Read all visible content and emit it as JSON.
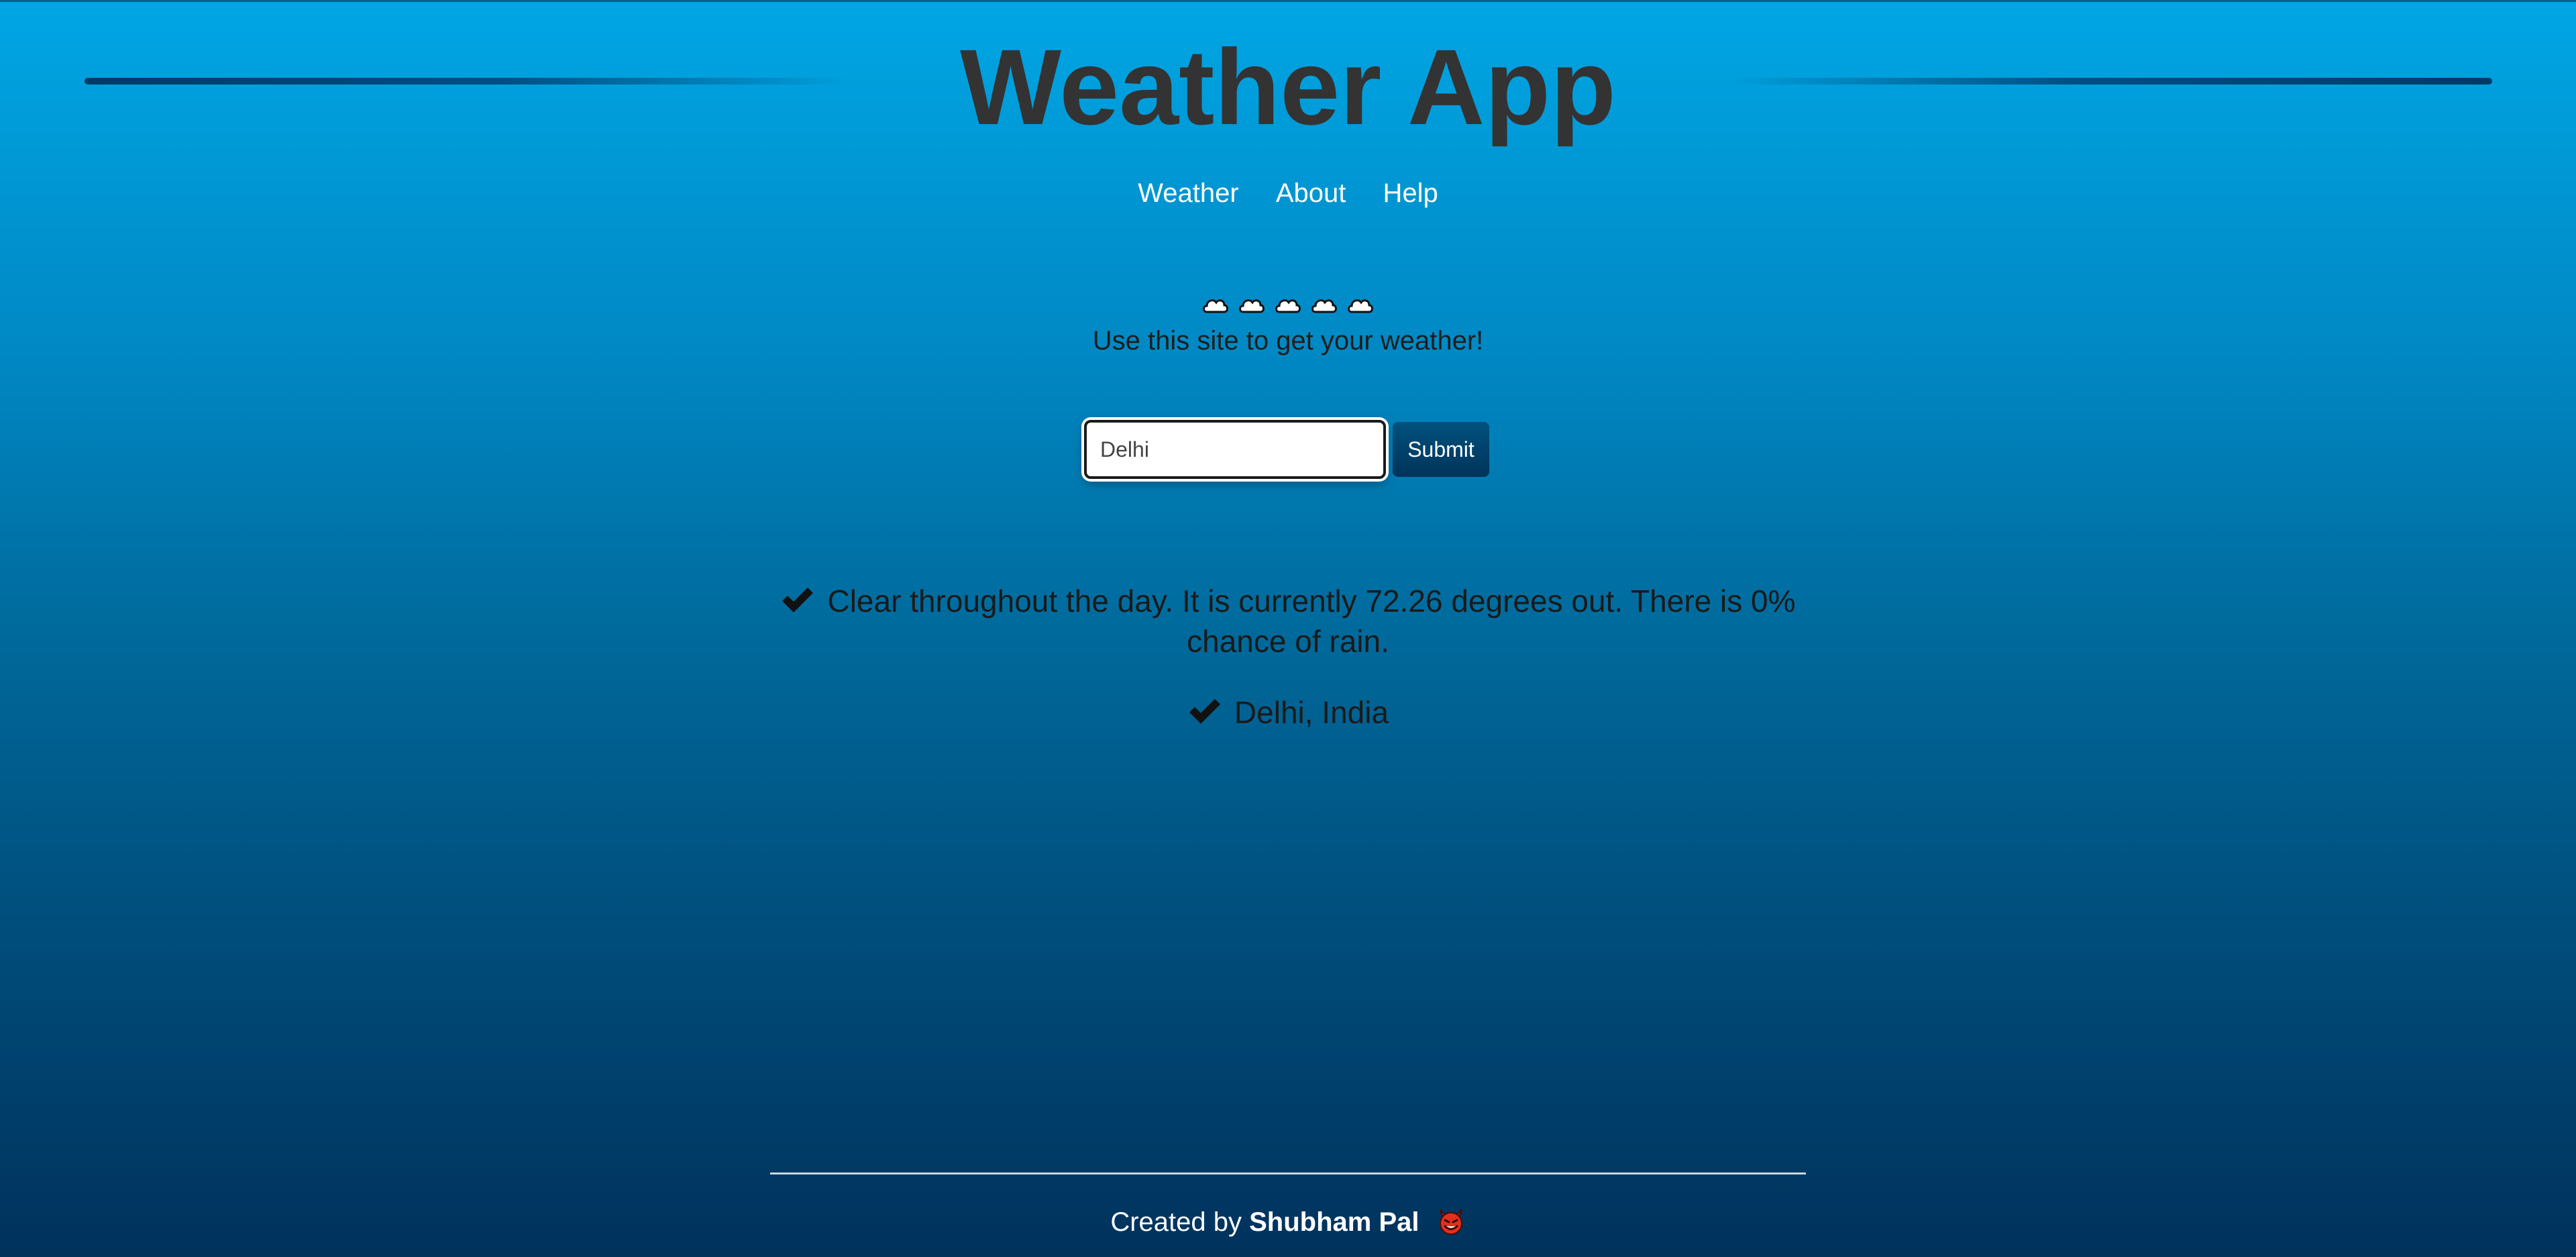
{
  "header": {
    "title": "Weather App",
    "nav": [
      {
        "label": "Weather"
      },
      {
        "label": "About"
      },
      {
        "label": "Help"
      }
    ]
  },
  "main": {
    "cloud_icons": [
      "cloud-icon",
      "cloud-icon",
      "cloud-icon",
      "cloud-icon",
      "cloud-icon"
    ],
    "intro": "Use this site to get your weather!",
    "search": {
      "value": "Delhi",
      "submit_label": "Submit"
    },
    "results": {
      "forecast": "Clear throughout the day. It is currently 72.26 degrees out. There is 0% chance of rain.",
      "location": "Delhi, India"
    }
  },
  "footer": {
    "prefix": "Created by ",
    "author": "Shubham Pal",
    "emoji_icon": "devil-face-icon"
  },
  "colors": {
    "title": "#333333",
    "button": "#003a66",
    "rule": "#003a66"
  }
}
